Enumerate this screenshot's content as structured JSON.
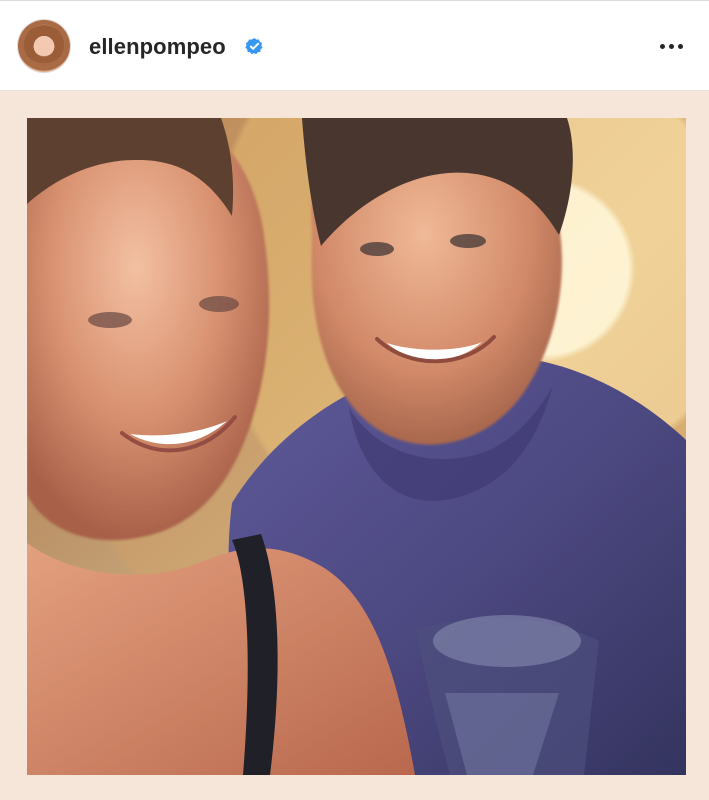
{
  "post": {
    "username": "ellenpompeo",
    "verified": true
  },
  "icons": {
    "avatar": "profile-avatar",
    "verified": "verified-badge-icon",
    "more": "more-options-icon"
  },
  "colors": {
    "header_background": "#ffffff",
    "username_text": "#262626",
    "verified_blue": "#3897f0",
    "frame_background": "#f6e6da",
    "shirt_purple": "#4f4b86"
  }
}
